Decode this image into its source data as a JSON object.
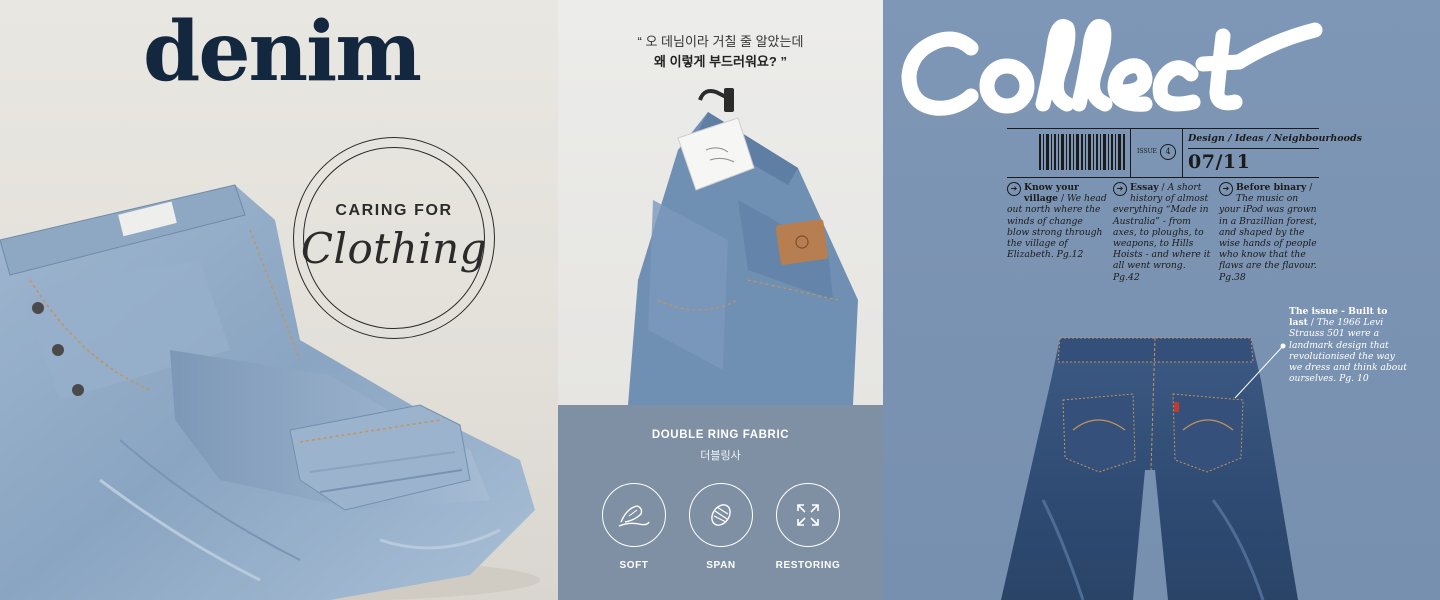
{
  "left_panel": {
    "brand": "denim",
    "badge_line1": "CARING FOR",
    "badge_line2": "Clothing"
  },
  "middle_panel": {
    "quote_line1": "“ 오 데님이라 거칠 줄 알았는데",
    "quote_line2": "왜 이렇게 부드러워요? ”",
    "fabric_title": "DOUBLE RING FABRIC",
    "fabric_subtitle": "더블링사",
    "features": [
      {
        "label": "SOFT",
        "icon": "feather-hand-icon"
      },
      {
        "label": "SPAN",
        "icon": "stretch-coil-icon"
      },
      {
        "label": "RESTORING",
        "icon": "expand-arrows-icon"
      }
    ]
  },
  "right_panel": {
    "title": "Collect",
    "issue_label": "ISSUE",
    "issue_number": "4",
    "tagline": "Design / Ideas / Neighbourhoods",
    "date": "07/11",
    "columns": [
      {
        "heading": "Know your village",
        "body": "We head out north where the winds of change blow strong through the village of Elizabeth. Pg.12"
      },
      {
        "heading": "Essay",
        "body": "A short history of almost everything “Made in Australia” - from axes, to ploughs, to weapons, to Hills Hoists - and where it all went wrong. Pg.42"
      },
      {
        "heading": "Before binary",
        "body": "The music on your iPod was grown in a Brazillian forest, and shaped by the wise hands of people who know that the flaws are the flavour. Pg.38"
      }
    ],
    "issue_note_heading": "The issue - Built to last",
    "issue_note_body": "The 1966 Levi Strauss 501 were a landmark design that revolutionised the way we dress and think about ourselves. Pg. 10"
  },
  "colors": {
    "brand_navy": "#13283f",
    "info_blue": "#7f90a4",
    "magazine_blue": "#7b93b2"
  }
}
